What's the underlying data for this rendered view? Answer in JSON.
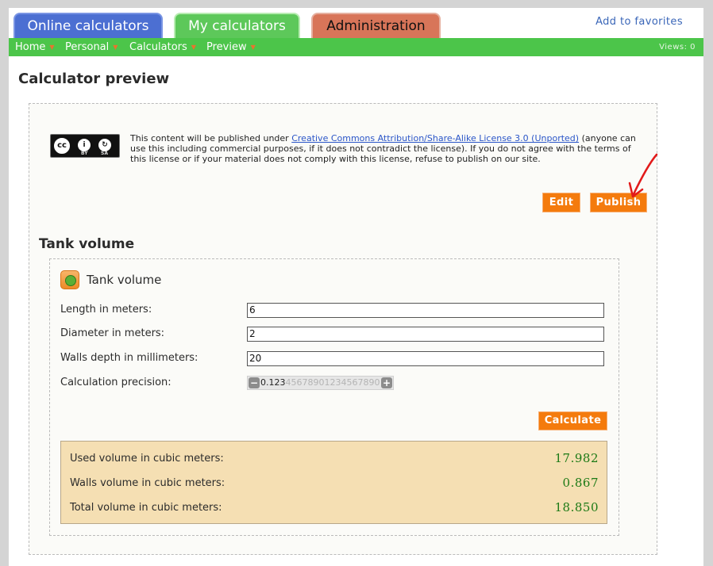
{
  "tabs": {
    "online": "Online calculators",
    "my": "My calculators",
    "admin": "Administration"
  },
  "add_favorites": "Add to favorites",
  "nav": {
    "items": [
      "Home",
      "Personal",
      "Calculators",
      "Preview"
    ],
    "views": "Views: 0"
  },
  "page_title": "Calculator preview",
  "license": {
    "cc_labels": {
      "cc": "cc",
      "by": "BY",
      "sa": "SA"
    },
    "text_before": "This content will be published under ",
    "link": "Creative Commons Attribution/Share-Alike License 3.0 (Unported)",
    "text_after": " (anyone can use this including commercial purposes, if it does not contradict the license). If you do not agree with the terms of this license or if your material does not comply with this license, refuse to publish on our site."
  },
  "actions": {
    "edit": "Edit",
    "publish": "Publish"
  },
  "calc": {
    "heading": "Tank volume",
    "title": "Tank volume",
    "fields": [
      {
        "label": "Length in meters:",
        "value": "6"
      },
      {
        "label": "Diameter in meters:",
        "value": "2"
      },
      {
        "label": "Walls depth in millimeters:",
        "value": "20"
      }
    ],
    "precision": {
      "label": "Calculation precision:",
      "active": "0.123",
      "faded": "45678901234567890"
    },
    "calculate": "Calculate",
    "results": [
      {
        "label": "Used volume in cubic meters:",
        "value": "17.982"
      },
      {
        "label": "Walls volume in cubic meters:",
        "value": "0.867"
      },
      {
        "label": "Total volume in cubic meters:",
        "value": "18.850"
      }
    ]
  },
  "colors": {
    "nav_green": "#4cc54a",
    "button_orange": "#f47b0d",
    "result_bg": "#f5dfb3",
    "result_value": "#1d7a16",
    "arrow_red": "#e21a1a"
  }
}
